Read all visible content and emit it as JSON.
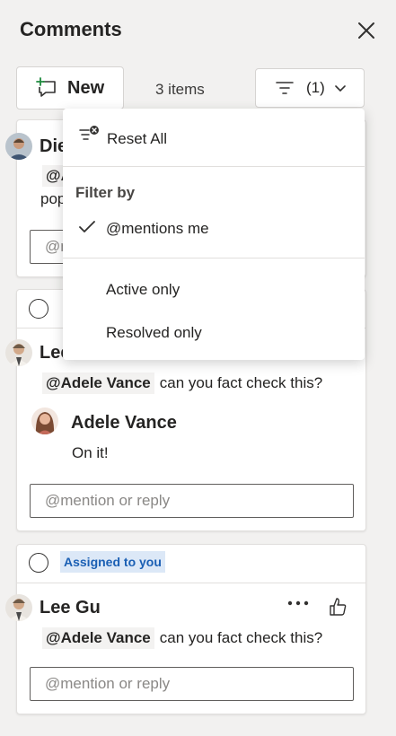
{
  "header": {
    "title": "Comments"
  },
  "toolbar": {
    "new_label": "New",
    "item_count": "3 items",
    "filter_label": "(1)"
  },
  "dropdown": {
    "reset_label": "Reset All",
    "filter_by_heading": "Filter by",
    "options": [
      {
        "label": "@mentions me",
        "checked": true
      },
      {
        "label": "Active only",
        "checked": false
      },
      {
        "label": "Resolved only",
        "checked": false
      }
    ]
  },
  "cards": [
    {
      "author_visible": "Die",
      "mention_visible": "@A",
      "text_visible": "pop",
      "reply_placeholder": "@m"
    },
    {
      "author_visible": "Lee",
      "mention": "@Adele Vance",
      "text": "can you fact check this?",
      "reply_author": "Adele Vance",
      "reply_text": "On it!",
      "reply_placeholder": "@mention or reply"
    },
    {
      "badge": "Assigned to you",
      "author": "Lee Gu",
      "mention": "@Adele Vance",
      "text": "can you fact check this?",
      "reply_placeholder": "@mention or reply"
    }
  ],
  "colors": {
    "accent_blue": "#1a5fb4",
    "badge_bg": "#dce8f7",
    "panel_bg": "#f2f1f0"
  }
}
